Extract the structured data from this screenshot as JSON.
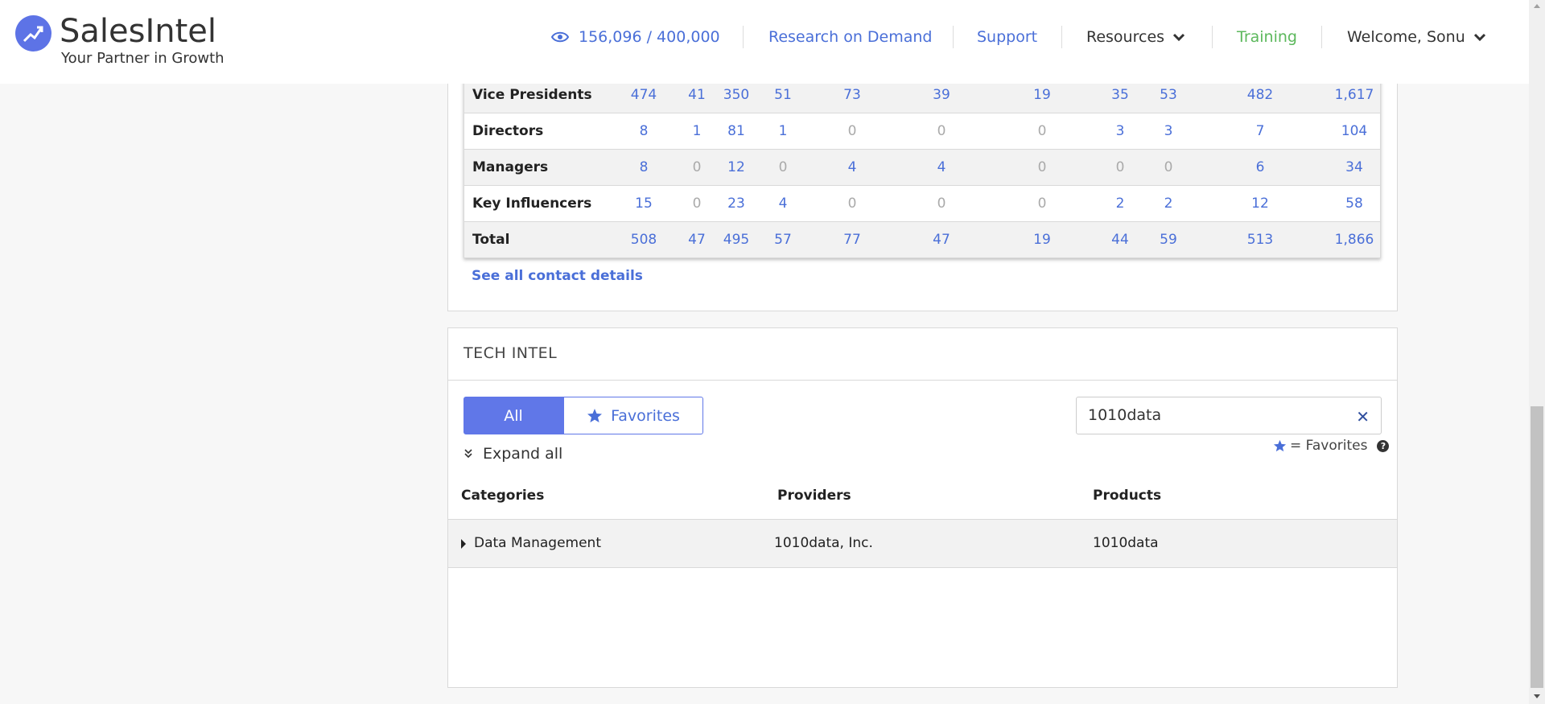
{
  "header": {
    "brand_name": "SalesIntel",
    "brand_tagline": "Your Partner in Growth",
    "credits": "156,096 / 400,000",
    "research": "Research on Demand",
    "support": "Support",
    "resources": "Resources",
    "training": "Training",
    "welcome": "Welcome, Sonu"
  },
  "contacts": {
    "rows": [
      {
        "label": "Vice Presidents",
        "values": [
          "474",
          "41",
          "350",
          "51",
          "73",
          "39",
          "19",
          "35",
          "53",
          "482",
          "1,617"
        ]
      },
      {
        "label": "Directors",
        "values": [
          "8",
          "1",
          "81",
          "1",
          "0",
          "0",
          "0",
          "3",
          "3",
          "7",
          "104"
        ]
      },
      {
        "label": "Managers",
        "values": [
          "8",
          "0",
          "12",
          "0",
          "4",
          "4",
          "0",
          "0",
          "0",
          "6",
          "34"
        ]
      },
      {
        "label": "Key Influencers",
        "values": [
          "15",
          "0",
          "23",
          "4",
          "0",
          "0",
          "0",
          "2",
          "2",
          "12",
          "58"
        ]
      },
      {
        "label": "Total",
        "values": [
          "508",
          "47",
          "495",
          "57",
          "77",
          "47",
          "19",
          "44",
          "59",
          "513",
          "1,866"
        ]
      }
    ],
    "see_all": "See all contact details"
  },
  "tech_intel": {
    "title": "TECH INTEL",
    "tab_all": "All",
    "tab_favorites": "Favorites",
    "expand_all": "Expand all",
    "search_value": "1010data",
    "legend": "= Favorites",
    "help": "?",
    "columns": [
      "Categories",
      "Providers",
      "Products"
    ],
    "row": {
      "category": "Data Management",
      "provider": "1010data, Inc.",
      "product": "1010data"
    }
  },
  "colors": {
    "accent": "#6077e8",
    "link": "#4a6fd8",
    "training": "#5cb85c"
  }
}
